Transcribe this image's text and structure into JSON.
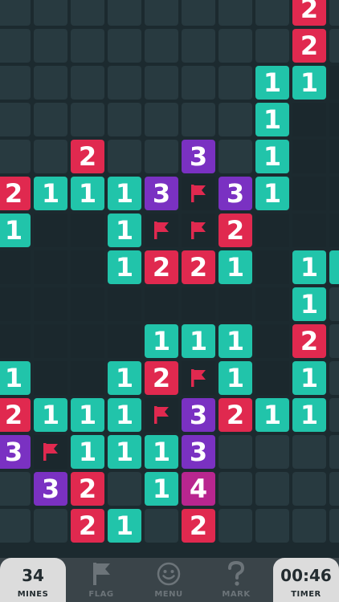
{
  "grid": {
    "cols": 10,
    "rows": 15,
    "cells": [
      "HHHHHHHH2H",
      "HHHHHHHH2H",
      "HHHHHHH11E",
      "HHHHHHH1EE",
      "HH2HH3H1EE",
      "21113F31EE",
      "1EE1FF2EEE",
      "EEE1221E11",
      "EEEEEEEE1H",
      "EEEE111E2H",
      "1EE12F1E1H",
      "2111F3211H",
      "3F1113HHHH",
      "H32H14HHHH",
      "HH21H2HHHH"
    ]
  },
  "colors": {
    "one": "#21c4aa",
    "two": "#e0294f",
    "three": "#7a31c2",
    "four": "#b8268f",
    "hidden": "#283a40",
    "flag": "#e0294f"
  },
  "bottom_bar": {
    "mines_count": "34",
    "mines_label": "MINES",
    "flag_label": "FLAG",
    "flag_icon": "flag-icon",
    "menu_label": "MENU",
    "menu_icon": "smiley-icon",
    "mark_label": "MARK",
    "mark_icon": "question-icon",
    "timer_value": "00:46",
    "timer_label": "TIMER"
  }
}
